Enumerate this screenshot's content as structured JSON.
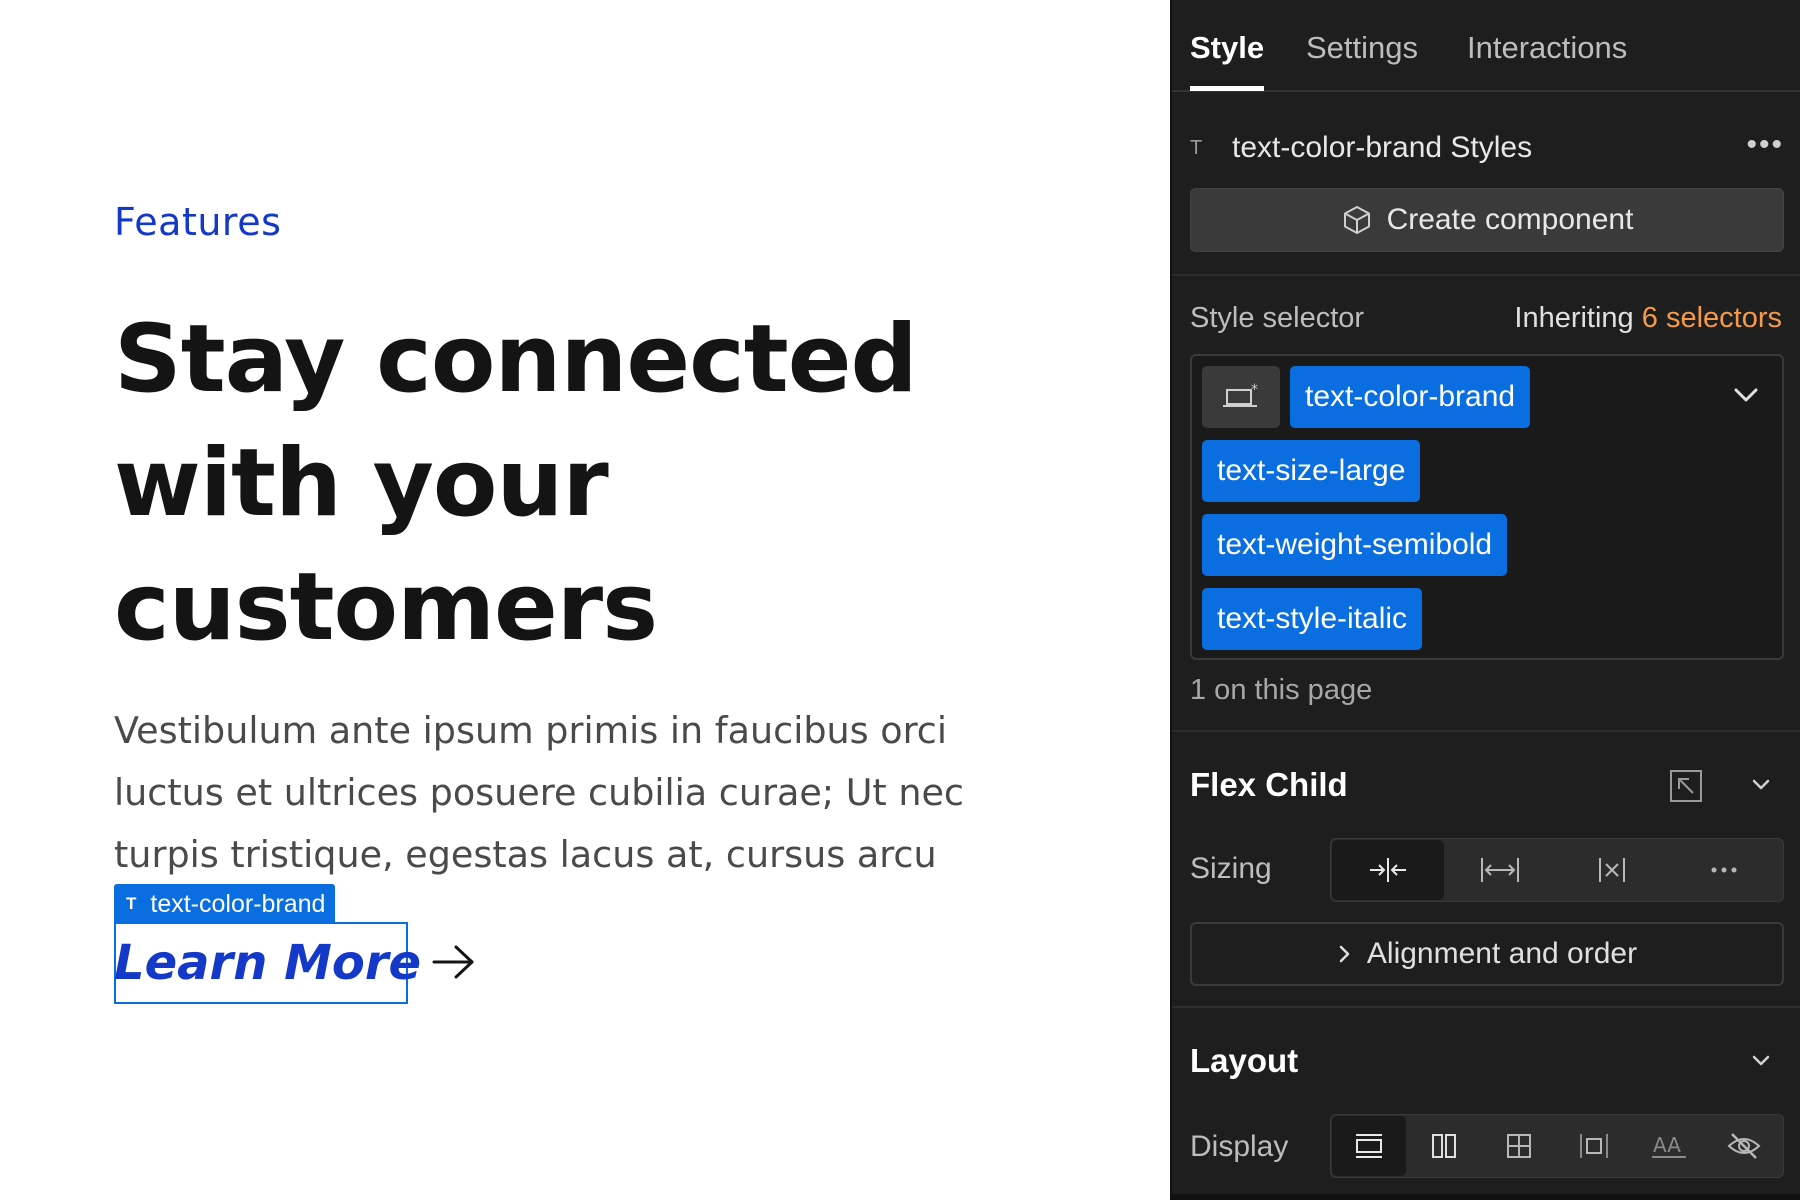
{
  "canvas": {
    "eyebrow": "Features",
    "headline_lines": [
      "Stay connected",
      "with your",
      "customers"
    ],
    "body_lines": [
      "Vestibulum ante ipsum primis in faucibus orci",
      "luctus et ultrices posuere cubilia curae; Ut nec",
      "turpis tristique, egestas lacus at, cursus arcu"
    ],
    "selection_tag": "text-color-brand",
    "selection_tag_icon": "text-type-icon",
    "link_label": "Learn More",
    "link_icon": "arrow-right-icon",
    "colors": {
      "brand": "#1438c8",
      "heading": "#141414",
      "body": "#4a4a4a",
      "selection": "#0a6de0"
    }
  },
  "panel": {
    "tabs": [
      {
        "label": "Style",
        "active": true
      },
      {
        "label": "Settings",
        "active": false
      },
      {
        "label": "Interactions",
        "active": false
      }
    ],
    "styles_header": "text-color-brand Styles",
    "more_icon": "more-horizontal-icon",
    "create_component": "Create component",
    "style_selector_label": "Style selector",
    "inheriting_prefix": "Inheriting",
    "inheriting_count": "6 selectors",
    "selectors": [
      "text-color-brand",
      "text-size-large",
      "text-weight-semibold",
      "text-style-italic"
    ],
    "on_page": "1 on this page",
    "flex_child": {
      "title": "Flex Child",
      "sizing_label": "Sizing",
      "sizing_options": [
        "shrink-icon",
        "grow-icon",
        "none-icon",
        "more-horizontal-icon"
      ],
      "sizing_active": 0,
      "alignment_button": "Alignment and order"
    },
    "layout": {
      "title": "Layout",
      "display_label": "Display",
      "display_options": [
        "block-icon",
        "flex-icon",
        "grid-icon",
        "inline-block-icon",
        "inline-icon",
        "none-icon"
      ],
      "display_active": 0
    },
    "colors": {
      "panel_bg": "#1e1e1e",
      "chip": "#0a6de0",
      "accent_orange": "#f59a4a"
    }
  }
}
